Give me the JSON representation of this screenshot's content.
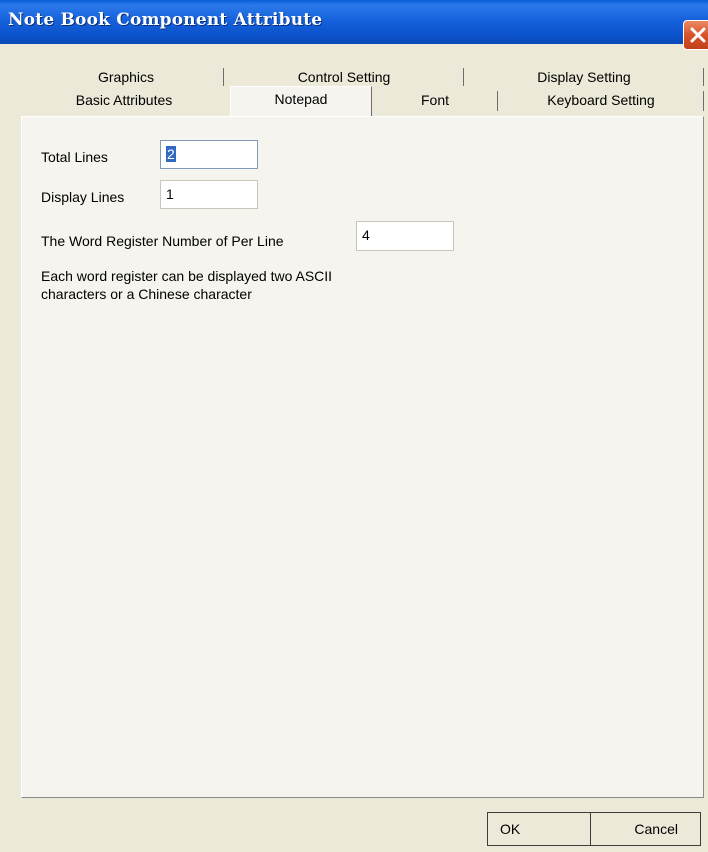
{
  "window": {
    "title": "Note Book Component Attribute"
  },
  "tabs": {
    "row1": [
      {
        "label": "Graphics"
      },
      {
        "label": "Control Setting"
      },
      {
        "label": "Display Setting"
      }
    ],
    "row2": [
      {
        "label": "Basic Attributes"
      },
      {
        "label": "Notepad"
      },
      {
        "label": "Font"
      },
      {
        "label": "Keyboard Setting"
      }
    ],
    "active": "Notepad"
  },
  "form": {
    "total_lines_label": "Total Lines",
    "total_lines_value": "2",
    "display_lines_label": "Display Lines",
    "display_lines_value": "1",
    "word_register_label": "The Word Register Number of Per Line",
    "word_register_value": "4",
    "note": "Each word register can be displayed two ASCII characters or a Chinese character"
  },
  "buttons": {
    "ok": "OK",
    "cancel": "Cancel"
  },
  "icons": {
    "close": "close-icon"
  },
  "colors": {
    "titlebar": "#0c53cc",
    "close": "#d9532a",
    "dialog_bg": "#ece9d8",
    "selection": "#316ac5"
  }
}
